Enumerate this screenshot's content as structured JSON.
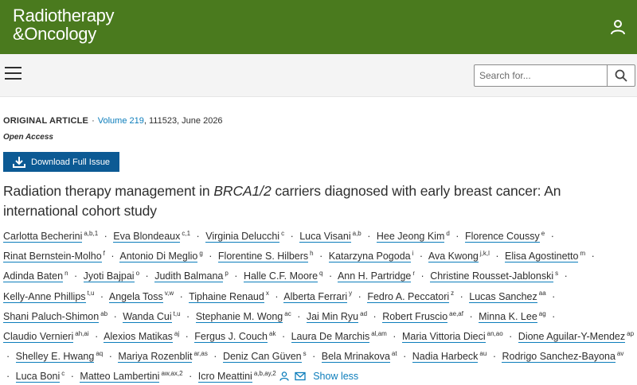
{
  "brand": {
    "line1": "Radiotherapy",
    "line2": "&Oncology",
    "bar_color": "#4a7a1e",
    "link_color": "#0c7dbb",
    "button_color": "#0c5a94"
  },
  "header": {
    "user_icon": "user-icon"
  },
  "nav": {
    "menu_icon": "hamburger-menu-icon"
  },
  "search": {
    "placeholder": "Search for...",
    "value": "",
    "icon": "search-icon"
  },
  "article": {
    "type_label": "ORIGINAL ARTICLE",
    "volume_link": "Volume 219",
    "issue_info": ", 111523, June 2026",
    "access": "Open Access",
    "download_label": "Download Full Issue",
    "title_pre": "Radiation therapy management in ",
    "title_italic": "BRCA1/2",
    "title_post": " carriers diagnosed with early breast cancer: An international cohort study"
  },
  "authors": [
    {
      "name": "Carlotta Becherini",
      "aff": "a,b,1"
    },
    {
      "name": "Eva Blondeaux",
      "aff": "c,1"
    },
    {
      "name": "Virginia Delucchi",
      "aff": "c"
    },
    {
      "name": "Luca Visani",
      "aff": "a,b"
    },
    {
      "name": "Hee Jeong Kim",
      "aff": "d"
    },
    {
      "name": "Florence Coussy",
      "aff": "e"
    },
    {
      "name": "Rinat Bernstein-Molho",
      "aff": "f"
    },
    {
      "name": "Antonio Di Meglio",
      "aff": "g"
    },
    {
      "name": "Florentine S. Hilbers",
      "aff": "h"
    },
    {
      "name": "Katarzyna Pogoda",
      "aff": "i"
    },
    {
      "name": "Ava Kwong",
      "aff": "j,k,l"
    },
    {
      "name": "Elisa Agostinetto",
      "aff": "m"
    },
    {
      "name": "Adinda Baten",
      "aff": "n"
    },
    {
      "name": "Jyoti Bajpai",
      "aff": "o"
    },
    {
      "name": "Judith Balmana",
      "aff": "p"
    },
    {
      "name": "Halle C.F. Moore",
      "aff": "q"
    },
    {
      "name": "Ann H. Partridge",
      "aff": "r"
    },
    {
      "name": "Christine Rousset-Jablonski",
      "aff": "s"
    },
    {
      "name": "Kelly-Anne Phillips",
      "aff": "t,u"
    },
    {
      "name": "Angela Toss",
      "aff": "v,w"
    },
    {
      "name": "Tiphaine Renaud",
      "aff": "x"
    },
    {
      "name": "Alberta Ferrari",
      "aff": "y"
    },
    {
      "name": "Fedro A. Peccatori",
      "aff": "z"
    },
    {
      "name": "Lucas Sanchez",
      "aff": "aa"
    },
    {
      "name": "Shani Paluch-Shimon",
      "aff": "ab"
    },
    {
      "name": "Wanda Cui",
      "aff": "t,u"
    },
    {
      "name": "Stephanie M. Wong",
      "aff": "ac"
    },
    {
      "name": "Jai Min Ryu",
      "aff": "ad"
    },
    {
      "name": "Robert Fruscio",
      "aff": "ae,af"
    },
    {
      "name": "Minna K. Lee",
      "aff": "ag"
    },
    {
      "name": "Claudio Vernieri",
      "aff": "ah,ai"
    },
    {
      "name": "Alexios Matikas",
      "aff": "aj"
    },
    {
      "name": "Fergus J. Couch",
      "aff": "ak"
    },
    {
      "name": "Laura De Marchis",
      "aff": "al,am"
    },
    {
      "name": "Maria Vittoria Dieci",
      "aff": "an,ao"
    },
    {
      "name": "Dione Aguilar-Y-Mendez",
      "aff": "ap"
    },
    {
      "name": "Shelley E. Hwang",
      "aff": "aq"
    },
    {
      "name": "Mariya Rozenblit",
      "aff": "ar,as"
    },
    {
      "name": "Deniz Can Güven",
      "aff": "s"
    },
    {
      "name": "Bela Mrinakova",
      "aff": "at"
    },
    {
      "name": "Nadia Harbeck",
      "aff": "au"
    },
    {
      "name": "Rodrigo Sanchez-Bayona",
      "aff": "av"
    },
    {
      "name": "Luca Boni",
      "aff": "c"
    },
    {
      "name": "Matteo Lambertini",
      "aff": "aw,ax,2"
    },
    {
      "name": "Icro Meattini",
      "aff": "a,b,ay,2",
      "icons": [
        "person-icon",
        "mail-icon"
      ]
    }
  ],
  "authors_toggle": "Show less"
}
